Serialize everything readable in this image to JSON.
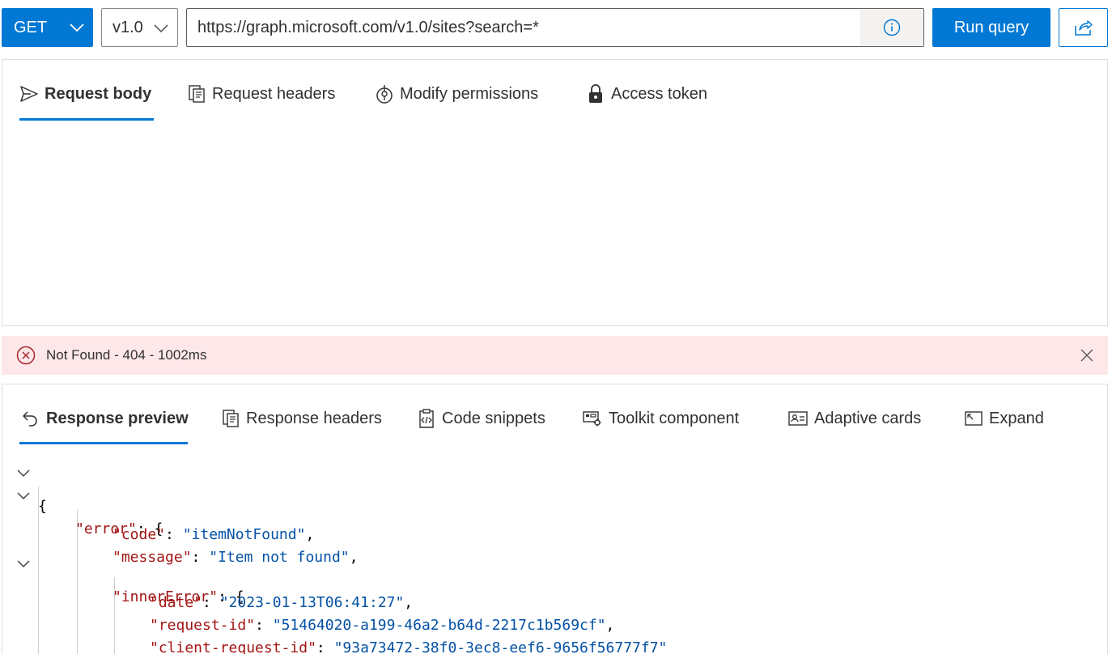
{
  "query_bar": {
    "method": "GET",
    "version": "v1.0",
    "url": "https://graph.microsoft.com/v1.0/sites?search=*",
    "run_label": "Run query",
    "icons": [
      "chevron-down-icon",
      "info-icon",
      "share-icon"
    ]
  },
  "request_tabs": [
    {
      "label": "Request body",
      "icon": "send-icon",
      "active": true
    },
    {
      "label": "Request headers",
      "icon": "document-list-icon",
      "active": false
    },
    {
      "label": "Modify permissions",
      "icon": "permissions-icon",
      "active": false
    },
    {
      "label": "Access token",
      "icon": "lock-icon",
      "active": false
    }
  ],
  "status": {
    "text": "Not Found - 404 - 1002ms",
    "type": "error",
    "color": "#fde7e9"
  },
  "response_tabs": [
    {
      "label": "Response preview",
      "icon": "undo-arrow-icon",
      "active": true
    },
    {
      "label": "Response headers",
      "icon": "document-list-icon",
      "active": false
    },
    {
      "label": "Code snippets",
      "icon": "clipboard-code-icon",
      "active": false
    },
    {
      "label": "Toolkit component",
      "icon": "toolkit-icon",
      "active": false
    },
    {
      "label": "Adaptive cards",
      "icon": "contact-card-icon",
      "active": false
    },
    {
      "label": "Expand",
      "icon": "expand-icon",
      "active": false
    }
  ],
  "response_json": {
    "line1": "{",
    "line2_key": "\"error\"",
    "line2_rest": ": {",
    "line3_key": "\"code\"",
    "line3_sep": ": ",
    "line3_val": "\"itemNotFound\"",
    "line3_end": ",",
    "line4_key": "\"message\"",
    "line4_sep": ": ",
    "line4_val": "\"Item not found\"",
    "line4_end": ",",
    "line5_key": "\"innerError\"",
    "line5_rest": ": {",
    "line6_key": "\"date\"",
    "line6_sep": ": ",
    "line6_val": "\"2023-01-13T06:41:27\"",
    "line6_end": ",",
    "line7_key": "\"request-id\"",
    "line7_sep": ": ",
    "line7_val": "\"51464020-a199-46a2-b64d-2217c1b569cf\"",
    "line7_end": ",",
    "line8_key": "\"client-request-id\"",
    "line8_sep": ": ",
    "line8_val": "\"93a73472-38f0-3ec8-eef6-9656f56777f7\"",
    "line9": "}"
  },
  "colors": {
    "accent": "#0078d4",
    "json_key": "#a31515",
    "json_string": "#0451a5",
    "error_icon": "#a4262c"
  }
}
